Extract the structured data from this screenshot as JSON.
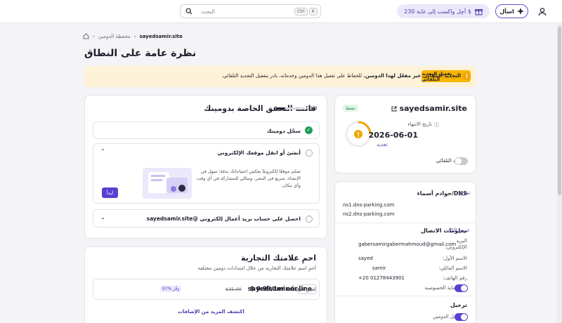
{
  "topbar": {
    "ask_label": "اسأل",
    "promo_label": "أحِل واكسب إلى غاية 230 $",
    "search_placeholder": "البحث",
    "shortcut_ctrl": "Ctrl",
    "shortcut_k": "K"
  },
  "breadcrumb": {
    "current": "sayedsamir.site",
    "parent": "محفظة الدومين"
  },
  "page": {
    "title": "نظرة عامة على النطاق"
  },
  "alert": {
    "bold_text": "التجديد التلقائي غير مفعّل لهذا الدومين.",
    "rest_text": " للحفاظ على تفعيل هذا الدومين وخدماته، بادر بتفعيل التجديد التلقائي.",
    "button_label": "تفعيل التجديد التلقائي"
  },
  "checklist": {
    "title": "قائمة التحقق الخاصة بدومينك",
    "progress_text": "1/3",
    "progress_fraction": 0.33,
    "items": [
      {
        "label": "سجّل دومينك",
        "done": true
      },
      {
        "label": "أنشئ أو انقل موقعك الإلكتروني",
        "done": false,
        "description": "صمّم موقعًا إلكترونيًا يعكس احتياجاتك بدقة؛ سهل في الإنشاء، سريع في النشر، ومثالي للمشاركة في أي وقت وأي مكان.",
        "button_label": "ابدأ"
      },
      {
        "label": "احصل على حساب بريد أعمال إلكتروني @sayedsamir.site",
        "done": false
      }
    ]
  },
  "brand": {
    "title": "احمِ علامتك التجارية",
    "subtitle": "أحمِ اسم علامتك التجارية من خلال امتدادات دومين مختلفة",
    "domain": "sayedsamir.online",
    "discount_badge": "97% وفّر",
    "old_price": "$35.99",
    "price": "$ 0.99/1er año",
    "buy_label": "اشترِ الآن",
    "more_link": "اكتشف المزيد من الإضافات"
  },
  "domain_card": {
    "name": "sayedsamir.site",
    "status": "نشط",
    "expiry_label": "تاريخ الانتهاء",
    "expiry_date": "2026-06-01",
    "renew_link": "تجديد",
    "auto_renew_label": "التجديد التلقائي",
    "auto_renew_on": false
  },
  "dns": {
    "title": "خوادم أسماء/DNS",
    "edit_link": "تحرير",
    "servers": [
      "ns1.dns-parking.com",
      "ns2.dns-parking.com"
    ]
  },
  "contact": {
    "title": "معلومات الاتصال",
    "view_all_link": "عرض الكل",
    "email_label": "البريد الإلكتروني:",
    "email": "gabersamirgabermahmoud@gmail.com",
    "first_name_label": "الاسم الأول:",
    "first_name": "sayed",
    "last_name_label": "الاسم العائلي:",
    "last_name": "samir",
    "phone_label": "رقم الهاتف:",
    "phone": "+20 01278443901",
    "privacy_label": "حماية الخصوصية",
    "privacy_on": true
  },
  "transfer": {
    "title": "ترحيل",
    "lock_label": "قفل الدومين",
    "lock_on": true
  },
  "colors": {
    "accent": "#5a3fd0",
    "success": "#1e9e5a",
    "warning": "#f7b500"
  }
}
